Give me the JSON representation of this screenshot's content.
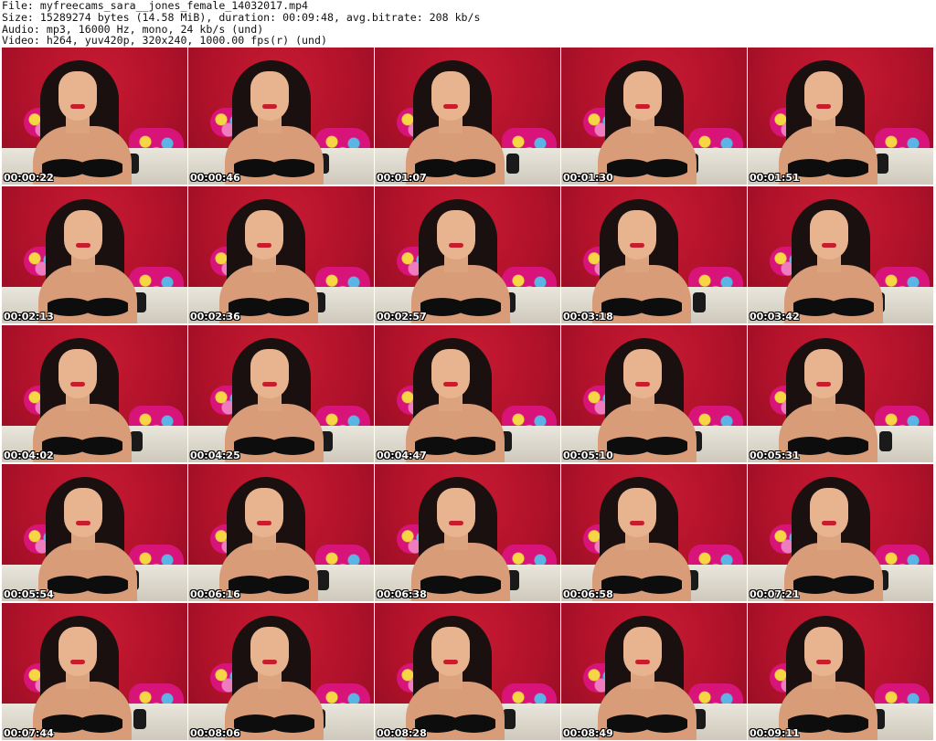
{
  "header": {
    "file_line": "File: myfreecams_sara__jones_female_14032017.mp4",
    "size_line": "Size: 15289274 bytes (14.58 MiB), duration: 00:09:48, avg.bitrate: 208 kb/s",
    "audio_line": "Audio: mp3, 16000 Hz, mono, 24 kb/s (und)",
    "video_line": "Video: h264, yuv420p, 320x240, 1000.00 fps(r) (und)"
  },
  "thumbnails": [
    "00:00:22",
    "00:00:46",
    "00:01:07",
    "00:01:30",
    "00:01:51",
    "00:02:13",
    "00:02:36",
    "00:02:57",
    "00:03:18",
    "00:03:42",
    "00:04:02",
    "00:04:25",
    "00:04:47",
    "00:05:10",
    "00:05:31",
    "00:05:54",
    "00:06:16",
    "00:06:38",
    "00:06:58",
    "00:07:21",
    "00:07:44",
    "00:08:06",
    "00:08:28",
    "00:08:49",
    "00:09:11"
  ],
  "colors": {
    "wall": "#b0132a",
    "timestamp_text": "#ffffff"
  }
}
